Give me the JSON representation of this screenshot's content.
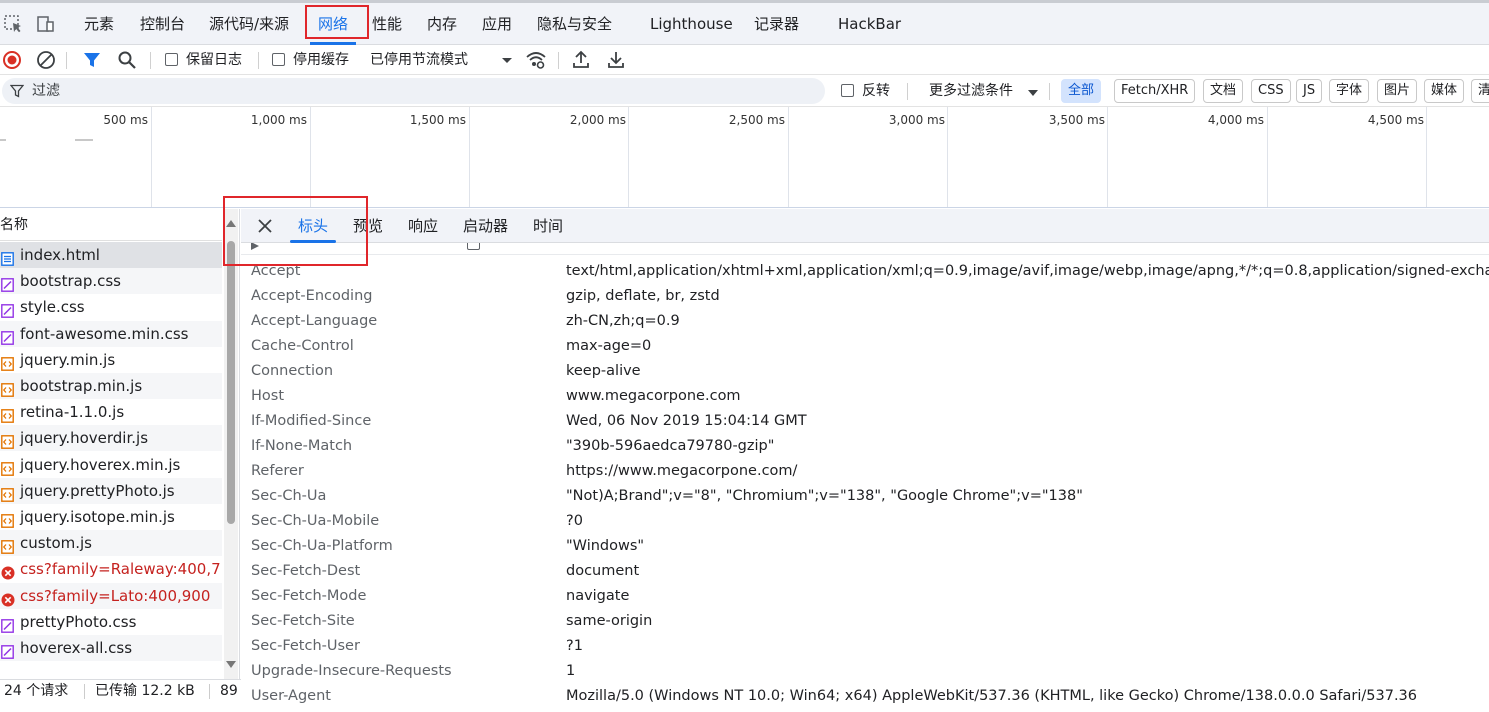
{
  "tabs": [
    "元素",
    "控制台",
    "源代码/来源",
    "网络",
    "性能",
    "内存",
    "应用",
    "隐私与安全",
    "Lighthouse",
    "记录器",
    "HackBar"
  ],
  "active_tab": "网络",
  "toolbar": {
    "preserve_log": "保留日志",
    "disable_cache": "停用缓存",
    "throttling": "已停用节流模式"
  },
  "filter": {
    "placeholder": "过滤",
    "invert": "反转",
    "more_filters": "更多过滤条件",
    "types": [
      "全部",
      "Fetch/XHR",
      "文档",
      "CSS",
      "JS",
      "字体",
      "图片",
      "媒体",
      "清"
    ]
  },
  "overview": {
    "ticks": [
      "500 ms",
      "1,000 ms",
      "1,500 ms",
      "2,000 ms",
      "2,500 ms",
      "3,000 ms",
      "3,500 ms",
      "4,000 ms",
      "4,500 ms"
    ]
  },
  "request_list": {
    "header": "名称",
    "rows": [
      {
        "name": "index.html",
        "type": "doc",
        "error": false
      },
      {
        "name": "bootstrap.css",
        "type": "css",
        "error": false
      },
      {
        "name": "style.css",
        "type": "css",
        "error": false
      },
      {
        "name": "font-awesome.min.css",
        "type": "css",
        "error": false
      },
      {
        "name": "jquery.min.js",
        "type": "js",
        "error": false
      },
      {
        "name": "bootstrap.min.js",
        "type": "js",
        "error": false
      },
      {
        "name": "retina-1.1.0.js",
        "type": "js",
        "error": false
      },
      {
        "name": "jquery.hoverdir.js",
        "type": "js",
        "error": false
      },
      {
        "name": "jquery.hoverex.min.js",
        "type": "js",
        "error": false
      },
      {
        "name": "jquery.prettyPhoto.js",
        "type": "js",
        "error": false
      },
      {
        "name": "jquery.isotope.min.js",
        "type": "js",
        "error": false
      },
      {
        "name": "custom.js",
        "type": "js",
        "error": false
      },
      {
        "name": "css?family=Raleway:400,7...",
        "type": "error",
        "error": true
      },
      {
        "name": "css?family=Lato:400,900",
        "type": "error",
        "error": true
      },
      {
        "name": "prettyPhoto.css",
        "type": "css",
        "error": false
      },
      {
        "name": "hoverex-all.css",
        "type": "css",
        "error": false
      }
    ]
  },
  "status": {
    "requests": "24 个请求",
    "transferred": "已传输 12.2 kB",
    "resources": "89"
  },
  "detail": {
    "tabs": [
      "标头",
      "预览",
      "响应",
      "启动器",
      "时间"
    ],
    "active_tab": "标头",
    "headers": [
      {
        "name": "Accept",
        "value": "text/html,application/xhtml+xml,application/xml;q=0.9,image/avif,image/webp,image/apng,*/*;q=0.8,application/signed-exchange"
      },
      {
        "name": "Accept-Encoding",
        "value": "gzip, deflate, br, zstd"
      },
      {
        "name": "Accept-Language",
        "value": "zh-CN,zh;q=0.9"
      },
      {
        "name": "Cache-Control",
        "value": "max-age=0"
      },
      {
        "name": "Connection",
        "value": "keep-alive"
      },
      {
        "name": "Host",
        "value": "www.megacorpone.com"
      },
      {
        "name": "If-Modified-Since",
        "value": "Wed, 06 Nov 2019 15:04:14 GMT"
      },
      {
        "name": "If-None-Match",
        "value": "\"390b-596aedca79780-gzip\""
      },
      {
        "name": "Referer",
        "value": "https://www.megacorpone.com/"
      },
      {
        "name": "Sec-Ch-Ua",
        "value": "\"Not)A;Brand\";v=\"8\", \"Chromium\";v=\"138\", \"Google Chrome\";v=\"138\""
      },
      {
        "name": "Sec-Ch-Ua-Mobile",
        "value": "?0"
      },
      {
        "name": "Sec-Ch-Ua-Platform",
        "value": "\"Windows\""
      },
      {
        "name": "Sec-Fetch-Dest",
        "value": "document"
      },
      {
        "name": "Sec-Fetch-Mode",
        "value": "navigate"
      },
      {
        "name": "Sec-Fetch-Site",
        "value": "same-origin"
      },
      {
        "name": "Sec-Fetch-User",
        "value": "?1"
      },
      {
        "name": "Upgrade-Insecure-Requests",
        "value": "1"
      },
      {
        "name": "User-Agent",
        "value": "Mozilla/5.0 (Windows NT 10.0; Win64; x64) AppleWebKit/537.36 (KHTML, like Gecko) Chrome/138.0.0.0 Safari/537.36"
      }
    ]
  },
  "colors": {
    "accent": "#1a73e8",
    "highlight_box": "#e0262b",
    "error_text": "#c5221f",
    "record_red": "#d93025"
  }
}
